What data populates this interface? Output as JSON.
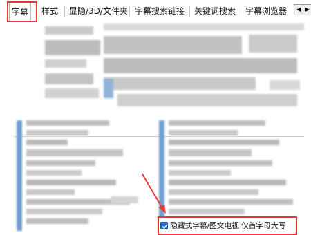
{
  "tabs": [
    {
      "label": "字幕",
      "active": true
    },
    {
      "label": "样式"
    },
    {
      "label": "显隐/3D/文件夹"
    },
    {
      "label": "字幕搜索链接"
    },
    {
      "label": "关键词搜索"
    },
    {
      "label": "字幕浏览器"
    }
  ],
  "scroll": {
    "left_icon": "chevron-left-icon",
    "right_icon": "chevron-right-icon"
  },
  "option": {
    "label": "隐藏式字幕/图文电视 仅首字母大写",
    "checked": true
  },
  "colors": {
    "annotation": "#e53935",
    "checkbox": "#1e73d6",
    "blur_gray": "#b3b3b3",
    "blur_blue": "#6f9fd2"
  }
}
